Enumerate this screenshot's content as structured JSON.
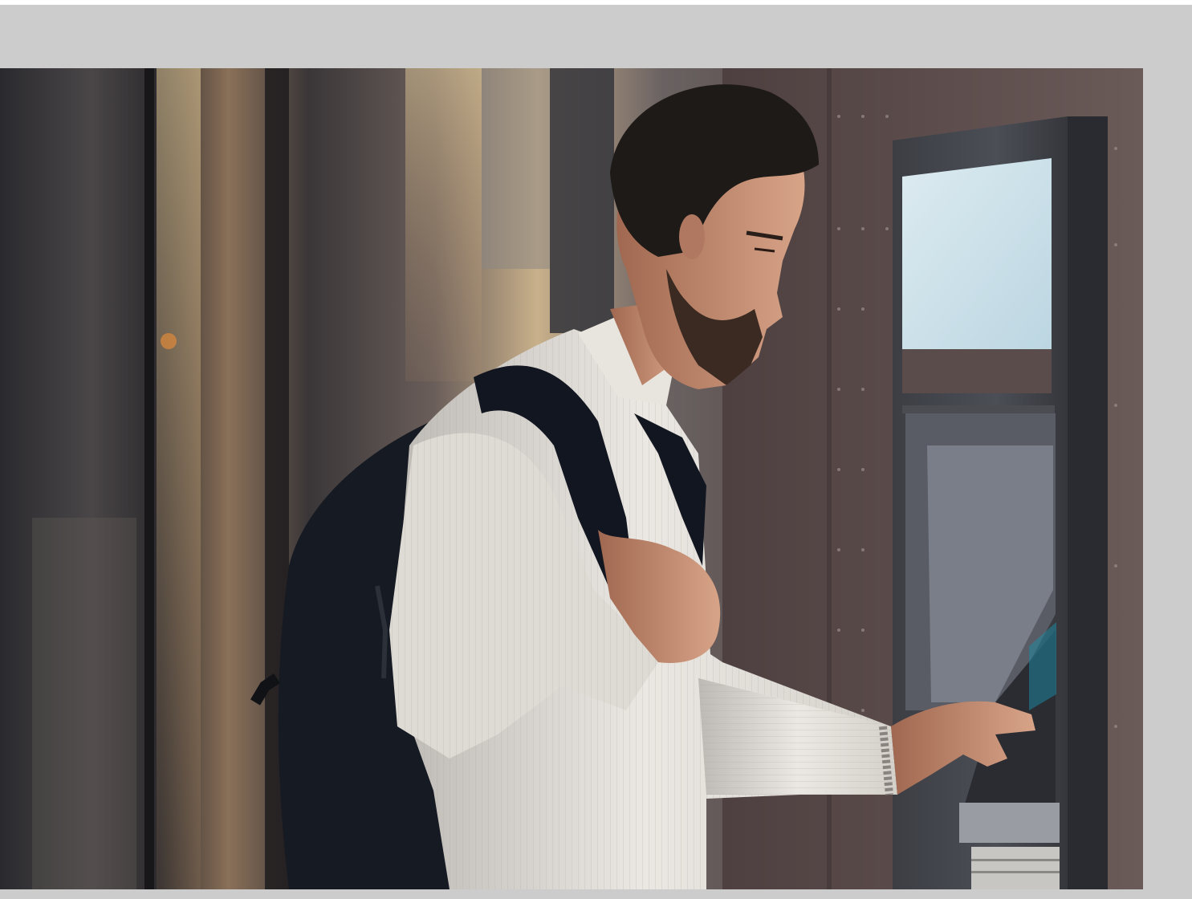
{
  "photo": {
    "subject": "person-using-atm",
    "colors": {
      "frame_gray": "#cccccc",
      "atm_screen": "#c9e0ea",
      "sweater": "#e6e2dc",
      "backpack": "#141820",
      "wall": "#5a4a48",
      "warm_light": "#e8c894"
    }
  }
}
